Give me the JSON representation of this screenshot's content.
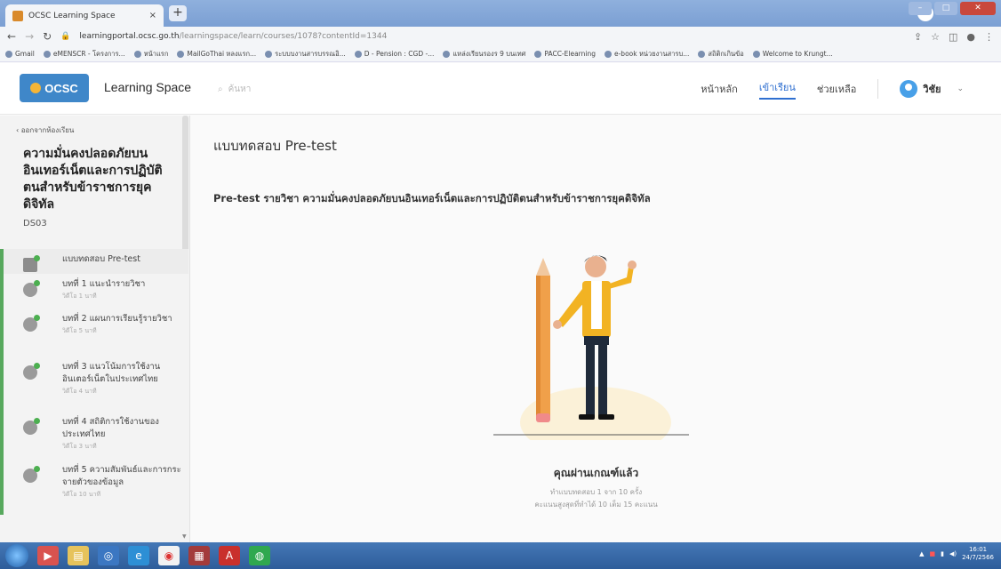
{
  "browser": {
    "tab_title": "OCSC Learning Space",
    "tab_close": "×",
    "new_tab": "+",
    "url_host": "learningportal.ocsc.go.th",
    "url_path": "/learningspace/learn/courses/1078?contentId=1344",
    "bookmarks": [
      "Gmail",
      "eMENSCR - โครงการ...",
      "หน้าแรก",
      "MailGoThai หลงแรก...",
      "ระบบบงานสารบรรณอิ...",
      "D - Pension : CGD -...",
      "แหล่งเรียนรองร 9 บนเทศ",
      "PACC-Elearning",
      "e-book หน่วยงานสารบ...",
      "สถิติกเกินข้อ",
      "Welcome to Krungt..."
    ]
  },
  "header": {
    "logo_text": "OCSC",
    "brand": "Learning Space",
    "search_placeholder": "ค้นหา",
    "nav": [
      "หน้าหลัก",
      "เข้าเรียน",
      "ช่วยเหลือ"
    ],
    "user_name": "วิชัย",
    "chevron": "⌄"
  },
  "sidebar": {
    "back_label": "ออกจากห้องเรียน",
    "course_title": "ความมั่นคงปลอดภัยบนอินเทอร์เน็ตและการปฏิบัติตนสำหรับข้าราชการยุคดิจิทัล",
    "course_code": "DS03",
    "lessons": [
      {
        "title": "แบบทดสอบ Pre-test",
        "sub": ""
      },
      {
        "title": "บทที่ 1 แนะนำรายวิชา",
        "sub": "วิดีโอ 1 นาที"
      },
      {
        "title": "บทที่ 2 แผนการเรียนรู้รายวิชา",
        "sub": "วิดีโอ 5 นาที"
      },
      {
        "title": "บทที่ 3 แนวโน้มการใช้งานอินเตอร์เน็ตในประเทศไทย",
        "sub": "วิดีโอ 4 นาที"
      },
      {
        "title": "บทที่ 4 สถิติการใช้งานของประเทศไทย",
        "sub": "วิดีโอ 3 นาที"
      },
      {
        "title": "บทที่ 5 ความสัมพันธ์และการกระจายตัวของข้อมูล",
        "sub": "วิดีโอ 10 นาที"
      }
    ]
  },
  "main": {
    "page_title": "แบบทดสอบ Pre-test",
    "subtitle": "Pre-test รายวิชา ความมั่นคงปลอดภัยบนอินเทอร์เน็ตและการปฏิบัติตนสำหรับข้าราชการยุคดิจิทัล",
    "result": "คุณผ่านเกณฑ์แล้ว",
    "info1": "ทำแบบทดสอบ 1 จาก 10 ครั้ง",
    "info2": "คะแนนสูงสุดที่ทำได้ 10 เต็ม 15 คะแนน"
  },
  "taskbar": {
    "time": "16:01",
    "date": "24/7/2566"
  },
  "colors": {
    "accent": "#2f6fd0",
    "logo_bg": "#3f87c9",
    "complete_green": "#4caf50",
    "pencil": "#f0a04a",
    "shirt": "#f2b323"
  }
}
